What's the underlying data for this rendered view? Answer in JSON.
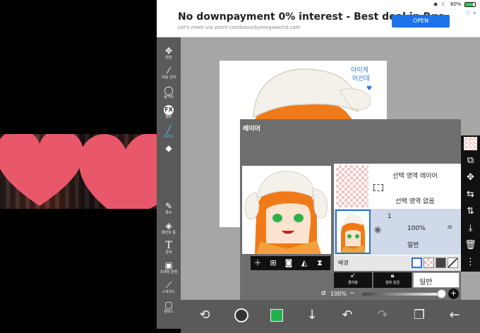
{
  "status": {
    "battery": "80%"
  },
  "ad": {
    "title": "No downpayment 0% interest - Best deal in Bgc",
    "subtitle": "Let's meet via zoom condotourbymegaworld.com",
    "open_label": "OPEN",
    "info_icon": "ⓘ ✕"
  },
  "toolbar": {
    "items": [
      {
        "icon": "move-icon",
        "label": "변형"
      },
      {
        "icon": "magic-wand-icon",
        "label": "자동 선택"
      },
      {
        "icon": "lasso-icon",
        "label": "올가미"
      },
      {
        "icon": "fx-icon",
        "glyph": "FX",
        "label": "필터"
      },
      {
        "icon": "brush-icon",
        "label": "브러시"
      },
      {
        "icon": "eraser-icon",
        "label": ""
      },
      {
        "icon": "blur-icon",
        "label": ""
      },
      {
        "icon": "fill-icon",
        "label": ""
      },
      {
        "icon": "special-icon",
        "label": "특수"
      },
      {
        "icon": "bucket-icon",
        "label": "페인트 통"
      },
      {
        "icon": "text-icon",
        "glyph": "T",
        "label": "문자"
      },
      {
        "icon": "frame-icon",
        "label": "프레임 분할"
      },
      {
        "icon": "eyedropper-icon",
        "label": "스포이드"
      },
      {
        "icon": "canvas-icon",
        "label": "캔버스"
      }
    ]
  },
  "canvas": {
    "handwriting": "아이게\n어선데"
  },
  "panel": {
    "title": "레이어",
    "selection_layer": {
      "name": "선택 영역 레이어",
      "state": "선택 영역 없음"
    },
    "layer1": {
      "name": "1",
      "opacity": "100%",
      "blend": "일반"
    },
    "background_label": "배경",
    "clip_label": "클리핑",
    "lock_label": "알파 잠금",
    "blend_select": "일반",
    "alpha_symbol": "α",
    "alpha_value": "100%",
    "alpha_level": 1.0
  },
  "colors": {
    "accent": "#4fc3f7",
    "primary_color": "#22b14c",
    "ad_button": "#1a73e8",
    "heart": "#e8576a"
  }
}
